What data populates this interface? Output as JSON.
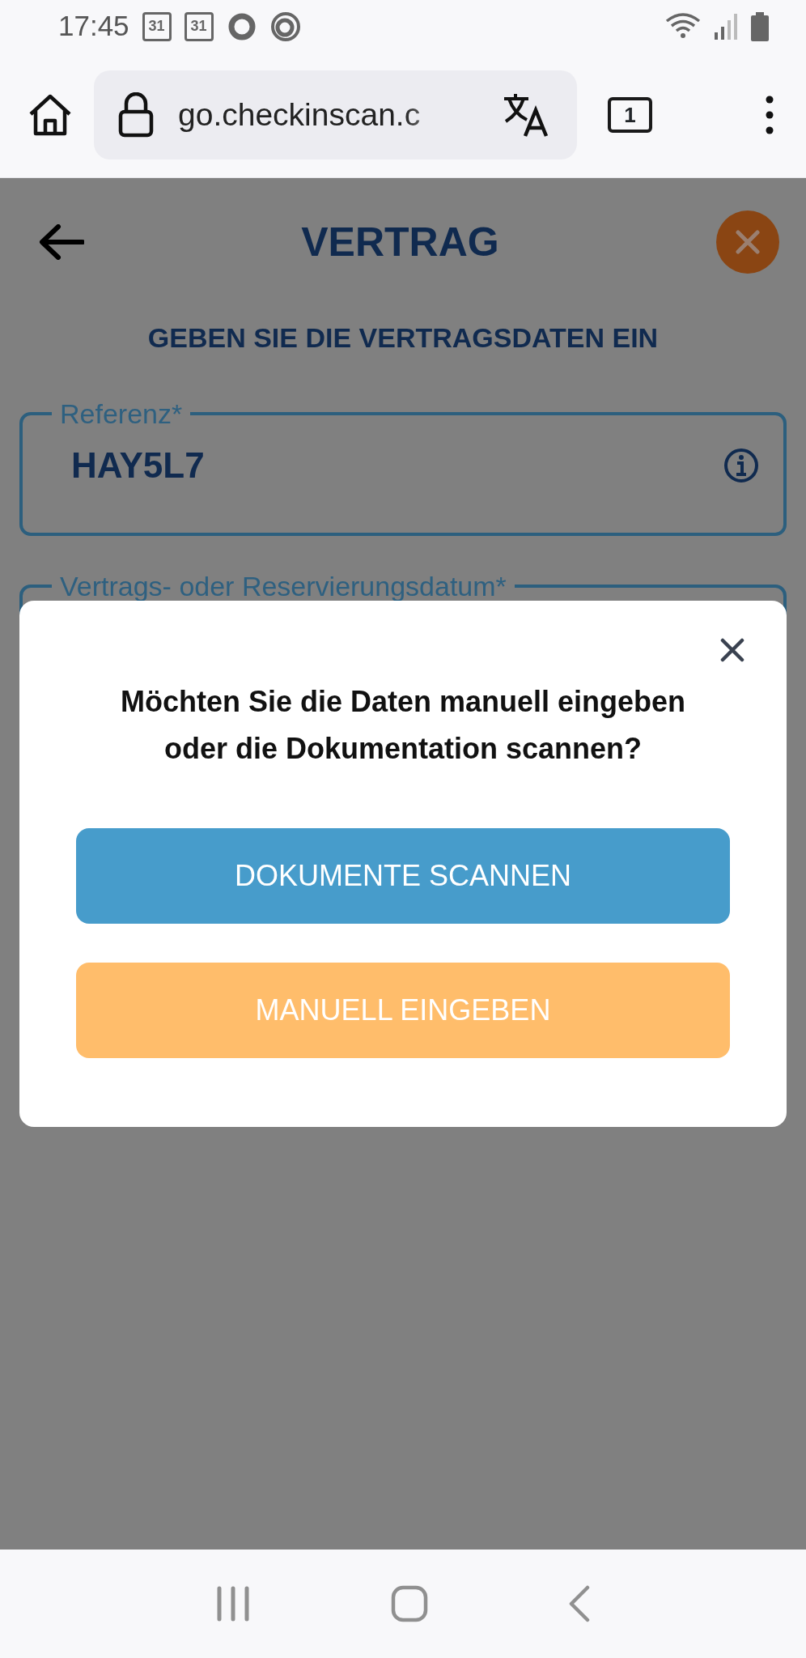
{
  "status_bar": {
    "time": "17:45",
    "notification_icons": [
      {
        "kind": "calendar",
        "label": "31"
      },
      {
        "kind": "calendar",
        "label": "31"
      },
      {
        "kind": "ring"
      },
      {
        "kind": "ring-double"
      }
    ]
  },
  "browser": {
    "url": "go.checkinscan.c",
    "tab_count": "1"
  },
  "page": {
    "title": "VERTRAG",
    "subtitle": "GEBEN SIE DIE VERTRAGSDATEN EIN",
    "fields": [
      {
        "label": "Referenz*",
        "value": "HAY5L7",
        "info": true
      },
      {
        "label": "Vertrags- oder Reservierungsdatum*"
      }
    ]
  },
  "dialog": {
    "message": "Möchten Sie die Daten manuell eingeben oder die Dokumentation scannen?",
    "buttons": [
      {
        "label": "DOKUMENTE SCANNEN",
        "kind": "primary"
      },
      {
        "label": "MANUELL EINGEBEN",
        "kind": "secondary"
      }
    ]
  }
}
